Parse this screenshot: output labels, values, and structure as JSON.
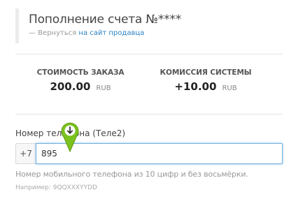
{
  "header": {
    "title": "Пополнение счета №****",
    "back_prefix": "— Вернуться",
    "back_link": "на сайт продавца"
  },
  "summary": {
    "order_cost_label": "СТОИМОСТЬ ЗАКАЗА",
    "order_cost_amount": "200.00",
    "order_cost_currency": "RUB",
    "commission_label": "КОМИССИЯ СИСТЕМЫ",
    "commission_amount": "+10.00",
    "commission_currency": "RUB"
  },
  "phone": {
    "label": "Номер телефона (Теле2)",
    "prefix": "+7",
    "value": "895",
    "hint": "Номер мобильного телефона из 10 цифр и без восьмёрки.",
    "example": "Например: 9QQXXXYYDD"
  },
  "colors": {
    "link": "#2a82c5",
    "marker": "#7cc21e",
    "input_focus_border": "#6fb0e0"
  },
  "icons": {
    "cursor_marker": "green-pin-down-arrow-icon"
  }
}
